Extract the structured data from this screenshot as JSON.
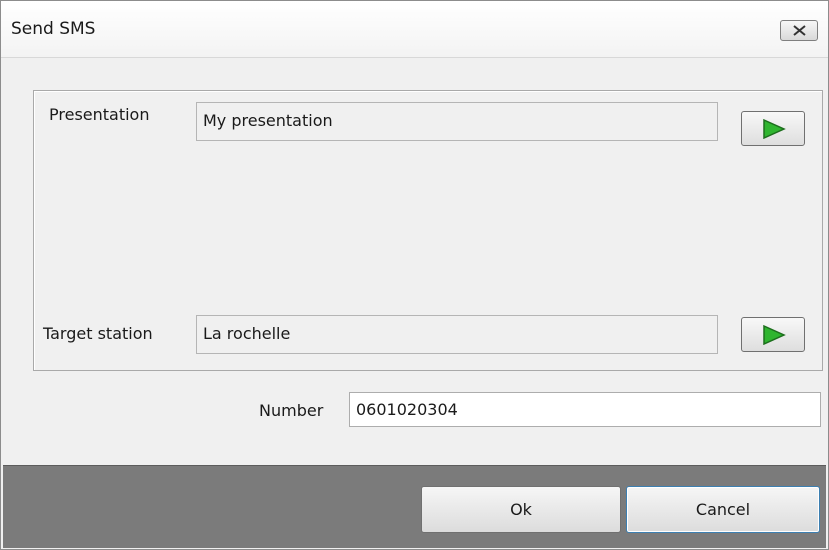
{
  "window": {
    "title": "Send SMS",
    "close_icon": "close-icon"
  },
  "form": {
    "presentation_label": "Presentation",
    "presentation_value": "My presentation",
    "target_station_label": "Target station",
    "target_station_value": "La rochelle",
    "number_label": "Number",
    "number_value": "0601020304",
    "go_icon": "play-arrow-icon"
  },
  "buttons": {
    "ok_label": "Ok",
    "cancel_label": "Cancel"
  },
  "colors": {
    "arrow_green": "#2fb52f",
    "footer_bg": "#7b7b7b"
  }
}
